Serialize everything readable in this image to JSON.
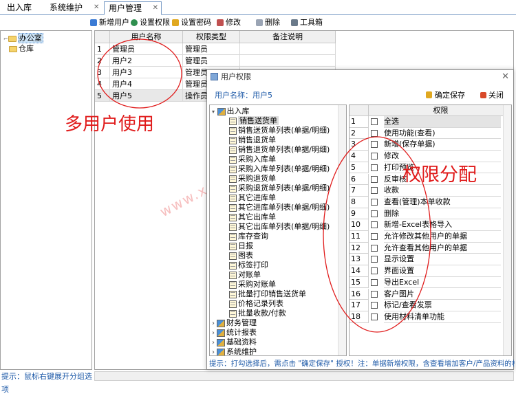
{
  "tabs": [
    {
      "label": "出入库"
    },
    {
      "label": "系统维护"
    },
    {
      "label": "用户管理"
    }
  ],
  "toolbar": {
    "add_user": "新增用户",
    "set_perm": "设置权限",
    "set_pwd": "设置密码",
    "modify": "修改",
    "delete": "删除",
    "toolbox": "工具箱"
  },
  "left_tree": {
    "items": [
      {
        "label": "办公室"
      },
      {
        "label": "仓库"
      }
    ]
  },
  "grid": {
    "headers": [
      "用户名称",
      "权限类型",
      "备注说明"
    ],
    "rows": [
      {
        "num": "1",
        "name": "管理员",
        "type": "管理员",
        "note": ""
      },
      {
        "num": "2",
        "name": "用户2",
        "type": "管理员",
        "note": ""
      },
      {
        "num": "3",
        "name": "用户3",
        "type": "管理员",
        "note": ""
      },
      {
        "num": "4",
        "name": "用户4",
        "type": "管理员",
        "note": ""
      },
      {
        "num": "5",
        "name": "用户5",
        "type": "操作员",
        "note": ""
      }
    ]
  },
  "status": "提示：鼠标右键展开分组选项",
  "annotations": {
    "multi_user": "多用户使用",
    "perm_assign": "权限分配"
  },
  "watermark": "www.xxxxxd.com",
  "dialog": {
    "title": "用户权限",
    "user_label": "用户名称：",
    "user_name": "用户5",
    "save": "确定保存",
    "close": "关闭",
    "tree": {
      "root": "出入库",
      "children": [
        "销售送货单",
        "销售送货单列表(单据/明细)",
        "销售退货单",
        "销售退货单列表(单据/明细)",
        "采购入库单",
        "采购入库单列表(单据/明细)",
        "采购退货单",
        "采购退货单列表(单据/明细)",
        "其它进库单",
        "其它进库单列表(单据/明细)",
        "其它出库单",
        "其它出库单列表(单据/明细)",
        "库存查询",
        "日报",
        "图表",
        "标签打印",
        "对账单",
        "采购对账单",
        "批量打印销售送货单",
        "价格记录列表",
        "批量收款/付款"
      ],
      "groups": [
        "财务管理",
        "统计报表",
        "基础资料",
        "系统维护"
      ]
    },
    "perm_header": "权限",
    "perms": [
      {
        "num": "1",
        "label": "全选"
      },
      {
        "num": "2",
        "label": "使用功能(查看)"
      },
      {
        "num": "3",
        "label": "新增(保存单据)"
      },
      {
        "num": "4",
        "label": "修改"
      },
      {
        "num": "5",
        "label": "打印预览"
      },
      {
        "num": "6",
        "label": "反审核"
      },
      {
        "num": "7",
        "label": "收款"
      },
      {
        "num": "8",
        "label": "查看(管理)本单收款"
      },
      {
        "num": "9",
        "label": "删除"
      },
      {
        "num": "10",
        "label": "新增-Excel表格导入"
      },
      {
        "num": "11",
        "label": "允许修改其他用户的单据"
      },
      {
        "num": "12",
        "label": "允许查看其他用户的单据"
      },
      {
        "num": "13",
        "label": "显示设置"
      },
      {
        "num": "14",
        "label": "界面设置"
      },
      {
        "num": "15",
        "label": "导出Excel"
      },
      {
        "num": "16",
        "label": "客户图片"
      },
      {
        "num": "17",
        "label": "标记/查看发票"
      },
      {
        "num": "18",
        "label": "使用材料清单功能"
      }
    ],
    "tip": "提示：打勾选择后，需点击 \"确定保存\" 授权！注：单据新增权限，含查看增加客户/产品资料的权限。"
  }
}
